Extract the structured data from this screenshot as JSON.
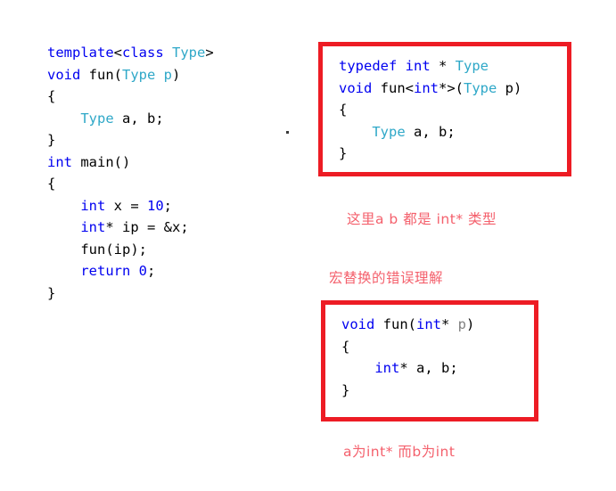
{
  "left_code": {
    "lines": [
      [
        {
          "t": "template",
          "c": "kw"
        },
        {
          "t": "<",
          "c": "plain"
        },
        {
          "t": "class",
          "c": "kw"
        },
        {
          "t": " ",
          "c": "plain"
        },
        {
          "t": "Type",
          "c": "type"
        },
        {
          "t": ">",
          "c": "plain"
        }
      ],
      [
        {
          "t": "void",
          "c": "kw"
        },
        {
          "t": " fun(",
          "c": "plain"
        },
        {
          "t": "Type",
          "c": "type"
        },
        {
          "t": " ",
          "c": "plain"
        },
        {
          "t": "p",
          "c": "type"
        },
        {
          "t": ")",
          "c": "plain"
        }
      ],
      [
        {
          "t": "{",
          "c": "plain"
        }
      ],
      [
        {
          "t": "    ",
          "c": "plain"
        },
        {
          "t": "Type",
          "c": "type"
        },
        {
          "t": " a, b;",
          "c": "plain"
        }
      ],
      [
        {
          "t": "}",
          "c": "plain"
        }
      ],
      [
        {
          "t": "int",
          "c": "kw"
        },
        {
          "t": " main()",
          "c": "plain"
        }
      ],
      [
        {
          "t": "{",
          "c": "plain"
        }
      ],
      [
        {
          "t": "    ",
          "c": "plain"
        },
        {
          "t": "int",
          "c": "kw"
        },
        {
          "t": " x = ",
          "c": "plain"
        },
        {
          "t": "10",
          "c": "num"
        },
        {
          "t": ";",
          "c": "plain"
        }
      ],
      [
        {
          "t": "    ",
          "c": "plain"
        },
        {
          "t": "int",
          "c": "kw"
        },
        {
          "t": "* ip = &x;",
          "c": "plain"
        }
      ],
      [
        {
          "t": "    fun(ip);",
          "c": "plain"
        }
      ],
      [
        {
          "t": "    ",
          "c": "plain"
        },
        {
          "t": "return",
          "c": "kw"
        },
        {
          "t": " ",
          "c": "plain"
        },
        {
          "t": "0",
          "c": "num"
        },
        {
          "t": ";",
          "c": "plain"
        }
      ],
      [
        {
          "t": "}",
          "c": "plain"
        }
      ]
    ]
  },
  "box_top": {
    "border_color": "#ed1c24",
    "lines": [
      [
        {
          "t": "typedef",
          "c": "kw"
        },
        {
          "t": " ",
          "c": "plain"
        },
        {
          "t": "int",
          "c": "kw"
        },
        {
          "t": " * ",
          "c": "plain"
        },
        {
          "t": "Type",
          "c": "type"
        }
      ],
      [
        {
          "t": "void",
          "c": "kw"
        },
        {
          "t": " fun<",
          "c": "plain"
        },
        {
          "t": "int",
          "c": "kw"
        },
        {
          "t": "*>(",
          "c": "plain"
        },
        {
          "t": "Type",
          "c": "type"
        },
        {
          "t": " p)",
          "c": "plain"
        }
      ],
      [
        {
          "t": "{",
          "c": "plain"
        }
      ],
      [
        {
          "t": "    ",
          "c": "plain"
        },
        {
          "t": "Type",
          "c": "type"
        },
        {
          "t": " a, b;",
          "c": "plain"
        }
      ],
      [
        {
          "t": "}",
          "c": "plain"
        }
      ]
    ]
  },
  "box_bottom": {
    "border_color": "#ed1c24",
    "lines": [
      [
        {
          "t": "void",
          "c": "kw"
        },
        {
          "t": " fun(",
          "c": "plain"
        },
        {
          "t": "int",
          "c": "kw"
        },
        {
          "t": "* ",
          "c": "plain"
        },
        {
          "t": "p",
          "c": "param"
        },
        {
          "t": ")",
          "c": "plain"
        }
      ],
      [
        {
          "t": "{",
          "c": "plain"
        }
      ],
      [
        {
          "t": "    ",
          "c": "plain"
        },
        {
          "t": "int",
          "c": "kw"
        },
        {
          "t": "* a, b;",
          "c": "plain"
        }
      ],
      [
        {
          "t": "}",
          "c": "plain"
        }
      ]
    ]
  },
  "notes": {
    "color": "#f4606c",
    "note_1": "这里a b 都是 int* 类型",
    "note_2": "宏替换的错误理解",
    "note_3": "a为int* 而b为int"
  }
}
